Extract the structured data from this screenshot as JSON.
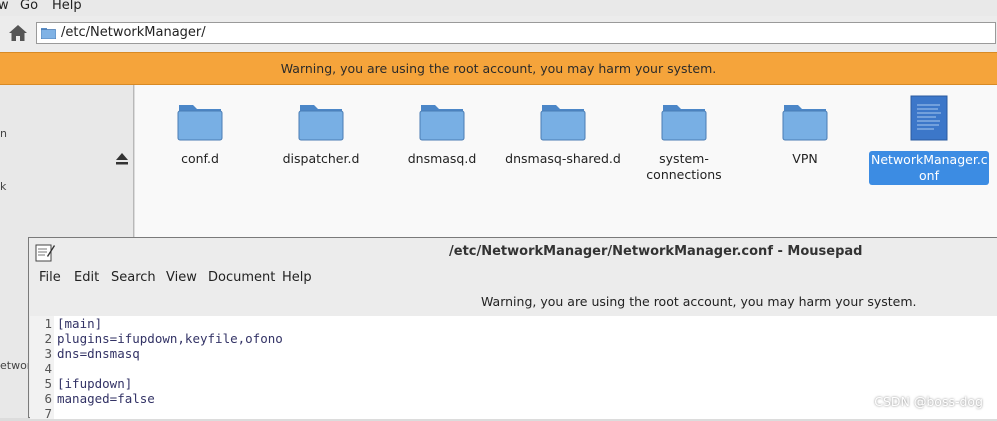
{
  "file_manager": {
    "menu": {
      "view_partial": "w",
      "go": "Go",
      "help": "Help"
    },
    "location": "/etc/NetworkManager/",
    "warning": "Warning, you are using the root account, you may harm your system.",
    "sidebar_partial": {
      "a": "n",
      "b": "k",
      "c": "etwork"
    },
    "items": [
      {
        "label": "conf.d",
        "type": "folder"
      },
      {
        "label": "dispatcher.d",
        "type": "folder"
      },
      {
        "label": "dnsmasq.d",
        "type": "folder"
      },
      {
        "label": "dnsmasq-shared.d",
        "type": "folder"
      },
      {
        "label": "system-connections",
        "type": "folder"
      },
      {
        "label": "VPN",
        "type": "folder"
      },
      {
        "label_line1": "NetworkManager.c",
        "label_line2": "onf",
        "type": "file",
        "selected": true
      }
    ]
  },
  "mousepad": {
    "title": "/etc/NetworkManager/NetworkManager.conf - Mousepad",
    "menu": [
      "File",
      "Edit",
      "Search",
      "View",
      "Document",
      "Help"
    ],
    "warning": "Warning, you are using the root account, you may harm your system.",
    "lines": [
      {
        "n": "1",
        "text": "[main]"
      },
      {
        "n": "2",
        "text": "plugins=ifupdown,keyfile,ofono"
      },
      {
        "n": "3",
        "text": "dns=dnsmasq"
      },
      {
        "n": "4",
        "text": ""
      },
      {
        "n": "5",
        "text": "[ifupdown]"
      },
      {
        "n": "6",
        "text": "managed=false"
      },
      {
        "n": "7",
        "text": ""
      }
    ]
  },
  "watermark": "CSDN @boss-dog",
  "colors": {
    "warning_bg": "#f5a43b",
    "selection": "#3c8ce3",
    "folder": "#6aa6de"
  }
}
